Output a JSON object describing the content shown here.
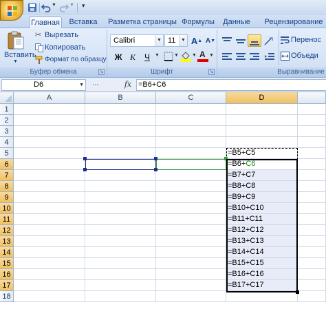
{
  "tabs": [
    {
      "label": "Главная",
      "active": true
    },
    {
      "label": "Вставка",
      "active": false
    },
    {
      "label": "Разметка страницы",
      "active": false
    },
    {
      "label": "Формулы",
      "active": false
    },
    {
      "label": "Данные",
      "active": false
    },
    {
      "label": "Рецензирование",
      "active": false
    }
  ],
  "clipboard": {
    "paste_label": "Вставить",
    "cut_label": "Вырезать",
    "copy_label": "Копировать",
    "format_painter_label": "Формат по образцу",
    "group_label": "Буфер обмена"
  },
  "font": {
    "name": "Calibri",
    "size": "11",
    "bold": "Ж",
    "italic": "К",
    "underline": "Ч",
    "grow": "A",
    "shrink": "A",
    "font_color_letter": "A",
    "group_label": "Шрифт"
  },
  "alignment": {
    "wrap_label": "Перенос",
    "merge_label": "Объеди",
    "group_label": "Выравнивание"
  },
  "formula_bar": {
    "name_box": "D6",
    "fx": "fx",
    "formula": "=B6+C6"
  },
  "columns": [
    "A",
    "B",
    "C",
    "D"
  ],
  "selected_column": "D",
  "rows": [
    "1",
    "2",
    "3",
    "4",
    "5",
    "6",
    "7",
    "8",
    "9",
    "10",
    "11",
    "12",
    "13",
    "14",
    "15",
    "16",
    "17",
    "18"
  ],
  "selected_rows": [
    "6",
    "7",
    "8",
    "9",
    "10",
    "11",
    "12",
    "13",
    "14",
    "15",
    "16",
    "17"
  ],
  "column_d": {
    "5": "=B5+C5",
    "6a": "=B6+",
    "6b": "C6",
    "7": "=B7+C7",
    "8": "=B8+C8",
    "9": "=B9+C9",
    "10": "=B10+C10",
    "11": "=B11+C11",
    "12": "=B12+C12",
    "13": "=B13+C13",
    "14": "=B14+C14",
    "15": "=B15+C15",
    "16": "=B16+C16",
    "17": "=B17+C17"
  },
  "colors": {
    "accent": "#15428b",
    "selection_fill": "#e8ecf8",
    "header_selected": "#f1c15f",
    "ref_green": "#1a8a1a",
    "ref_blue": "#00007f"
  }
}
